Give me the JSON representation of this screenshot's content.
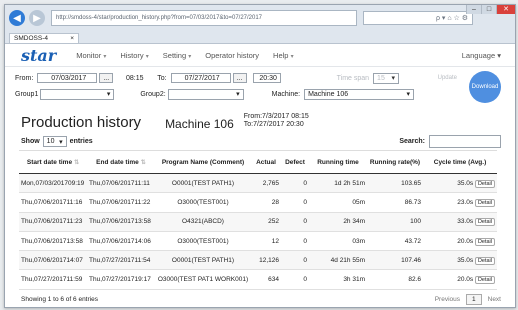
{
  "browser": {
    "address": "  http://smdoss-4/star/production_history.php?from=07/03/2017&to=07/27/2017",
    "search_hint": "ρ ▾ ⌂ ☆ ⚙",
    "tab_title": "SMDOSS-4",
    "tab_close": "×"
  },
  "menu": {
    "logo": "star",
    "items": [
      {
        "label": "Monitor"
      },
      {
        "label": "History"
      },
      {
        "label": "Setting"
      },
      {
        "label": "Operator history"
      },
      {
        "label": "Help"
      }
    ],
    "language": "Language"
  },
  "filters": {
    "from_label": "From:",
    "from_date": "07/03/2017",
    "from_time": "08:15",
    "to_label": "To:",
    "to_date": "07/27/2017",
    "to_time": "20:30",
    "group1_label": "Group1",
    "group1_value": "",
    "group2_label": "Group2:",
    "group2_value": "",
    "machine_label": "Machine:",
    "machine_value": "Machine 106",
    "faint_label": "Time span",
    "faint_value": "15",
    "update_label": "Update",
    "download_label": "Download",
    "dots": "..."
  },
  "title": {
    "page_title": "Production history",
    "machine": "Machine 106",
    "from": "From:7/3/2017 08:15",
    "to": "To:7/27/2017 20:30"
  },
  "controls": {
    "show_label": "Show",
    "page_size": "10",
    "entries_label": "entries",
    "search_label": "Search:"
  },
  "table": {
    "headers": [
      "Start date time",
      "End date time",
      "Program Name (Comment)",
      "Actual",
      "Defect",
      "Running time",
      "Running rate(%)",
      "Cycle time (Avg.)"
    ],
    "detail_label": "Detail",
    "rows": [
      [
        "Mon,07/03/201709:19",
        "Thu,07/06/201711:11",
        "O0001(TEST PATH1)",
        "2,765",
        "0",
        "1d 2h 51m",
        "103.65",
        "35.0s"
      ],
      [
        "Thu,07/06/201711:16",
        "Thu,07/06/201711:22",
        "O3000(TEST001)",
        "28",
        "0",
        "05m",
        "86.73",
        "23.0s"
      ],
      [
        "Thu,07/06/201711:23",
        "Thu,07/06/201713:58",
        "O4321(ABCD)",
        "252",
        "0",
        "2h 34m",
        "100",
        "33.0s"
      ],
      [
        "Thu,07/06/201713:58",
        "Thu,07/06/201714:06",
        "O3000(TEST001)",
        "12",
        "0",
        "03m",
        "43.72",
        "20.0s"
      ],
      [
        "Thu,07/06/201714:07",
        "Thu,07/27/201711:54",
        "O0001(TEST PATH1)",
        "12,126",
        "0",
        "4d 21h 55m",
        "107.46",
        "35.0s"
      ],
      [
        "Thu,07/27/201711:59",
        "Thu,07/27/201719:17",
        "O3000(TEST PAT1 WORK001)",
        "634",
        "0",
        "3h 31m",
        "82.6",
        "20.0s"
      ]
    ]
  },
  "footer": {
    "info": "Showing 1 to 6 of 6 entries",
    "previous": "Previous",
    "page": "1",
    "next": "Next"
  },
  "colors": {
    "brand": "#1a5fb4",
    "download": "#4f8fe0",
    "close": "#d9413b"
  }
}
